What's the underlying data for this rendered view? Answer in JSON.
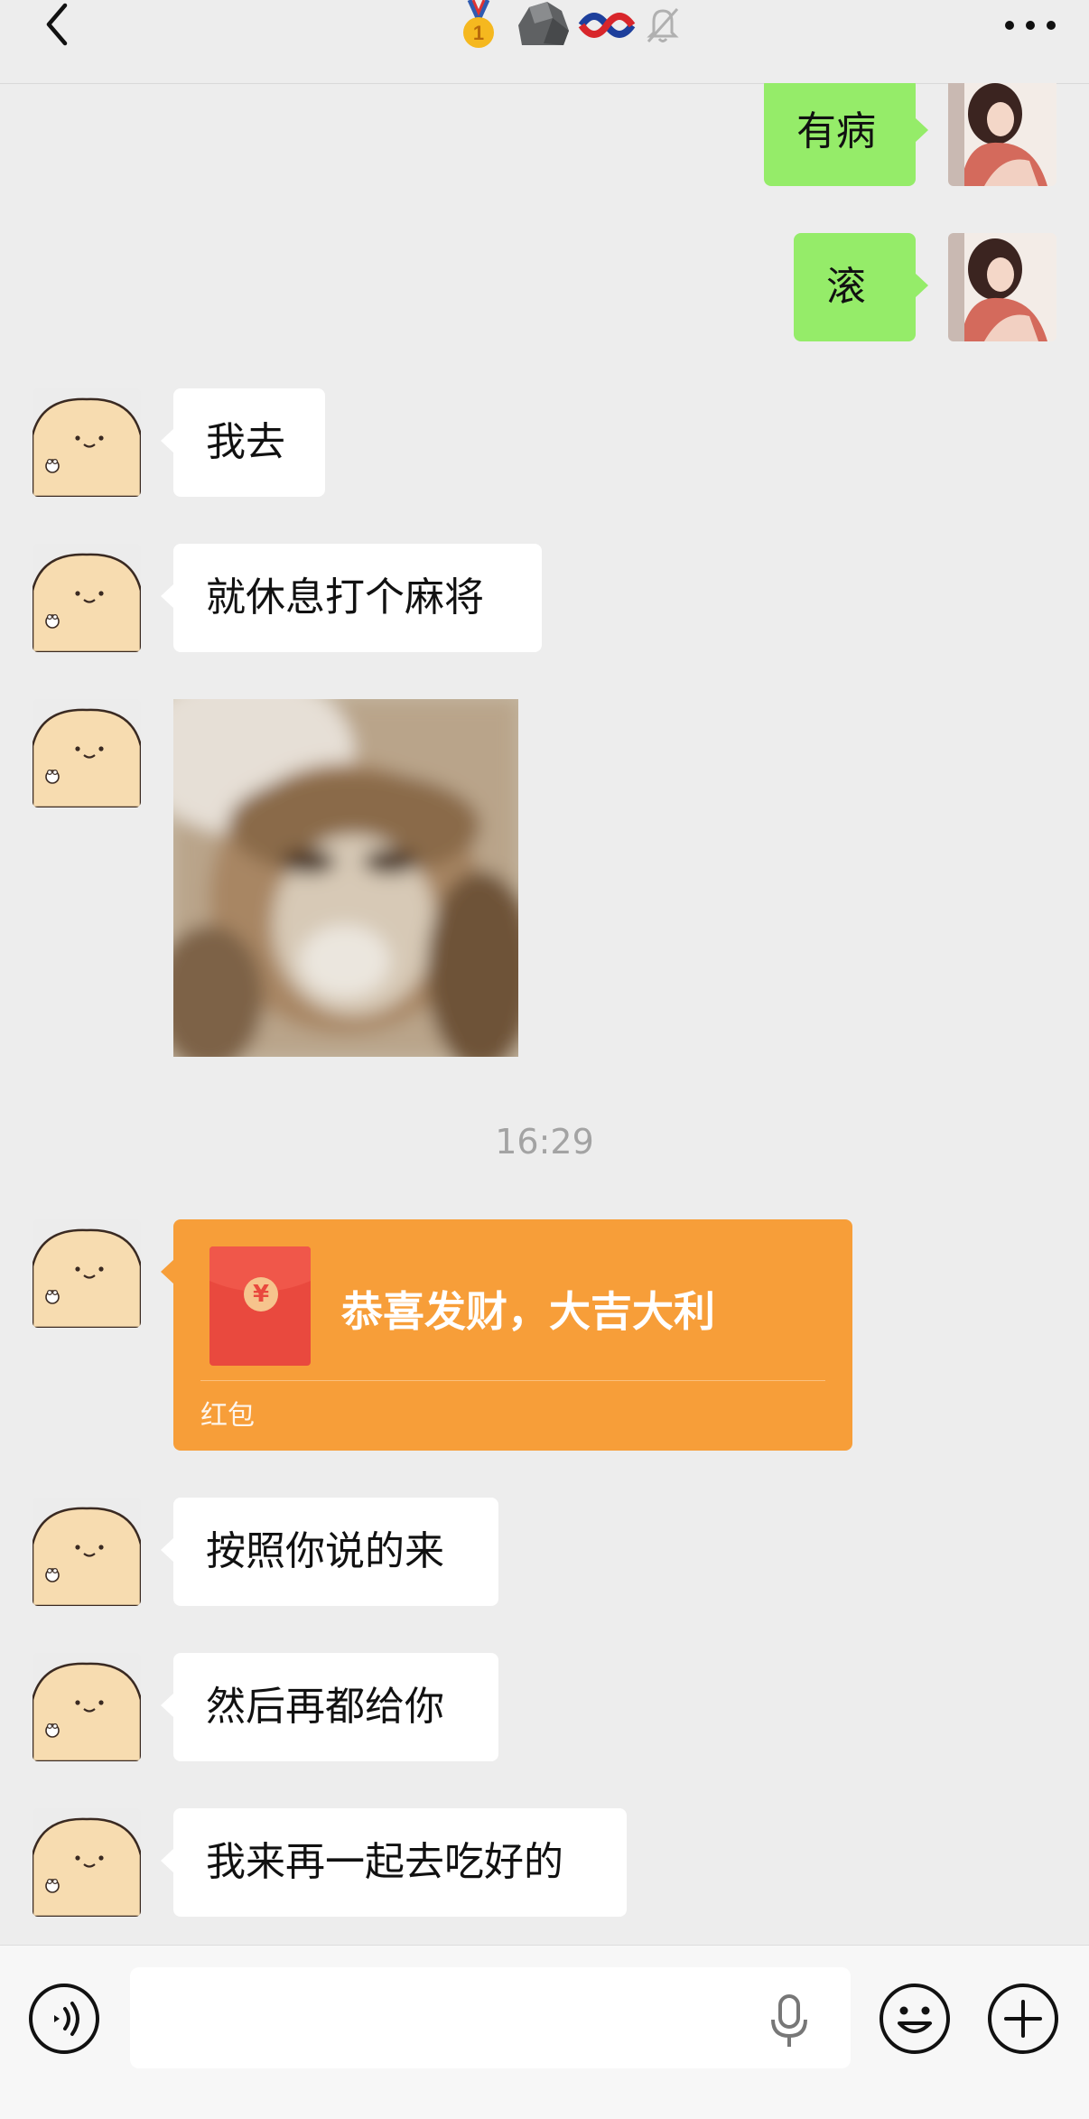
{
  "header": {
    "back_icon": "chevron-left-icon",
    "title_icons": [
      "medal-icon",
      "rock-icon",
      "knot-icon",
      "bell-muted-icon"
    ],
    "more_icon": "more-dots-icon"
  },
  "messages": [
    {
      "side": "right",
      "text": "有病"
    },
    {
      "side": "right",
      "text": "滚"
    },
    {
      "side": "left",
      "text": "我去"
    },
    {
      "side": "left",
      "text": "就休息打个麻将"
    },
    {
      "side": "left",
      "type": "sticker"
    },
    {
      "type": "timestamp",
      "text": "16:29"
    },
    {
      "side": "left",
      "type": "red_packet",
      "title": "恭喜发财，大吉大利",
      "label": "红包",
      "coin": "¥"
    },
    {
      "side": "left",
      "text": "按照你说的来"
    },
    {
      "side": "left",
      "text": "然后再都给你"
    },
    {
      "side": "left",
      "text": "我来再一起去吃好的"
    }
  ],
  "input_bar": {
    "voice_icon": "voice-mode-icon",
    "input_value": "",
    "mic_icon": "microphone-icon",
    "emoji_icon": "emoji-icon",
    "plus_icon": "plus-icon"
  },
  "colors": {
    "self_bubble": "#95ec69",
    "other_bubble": "#ffffff",
    "red_packet": "#f79e39",
    "background": "#ededed"
  }
}
